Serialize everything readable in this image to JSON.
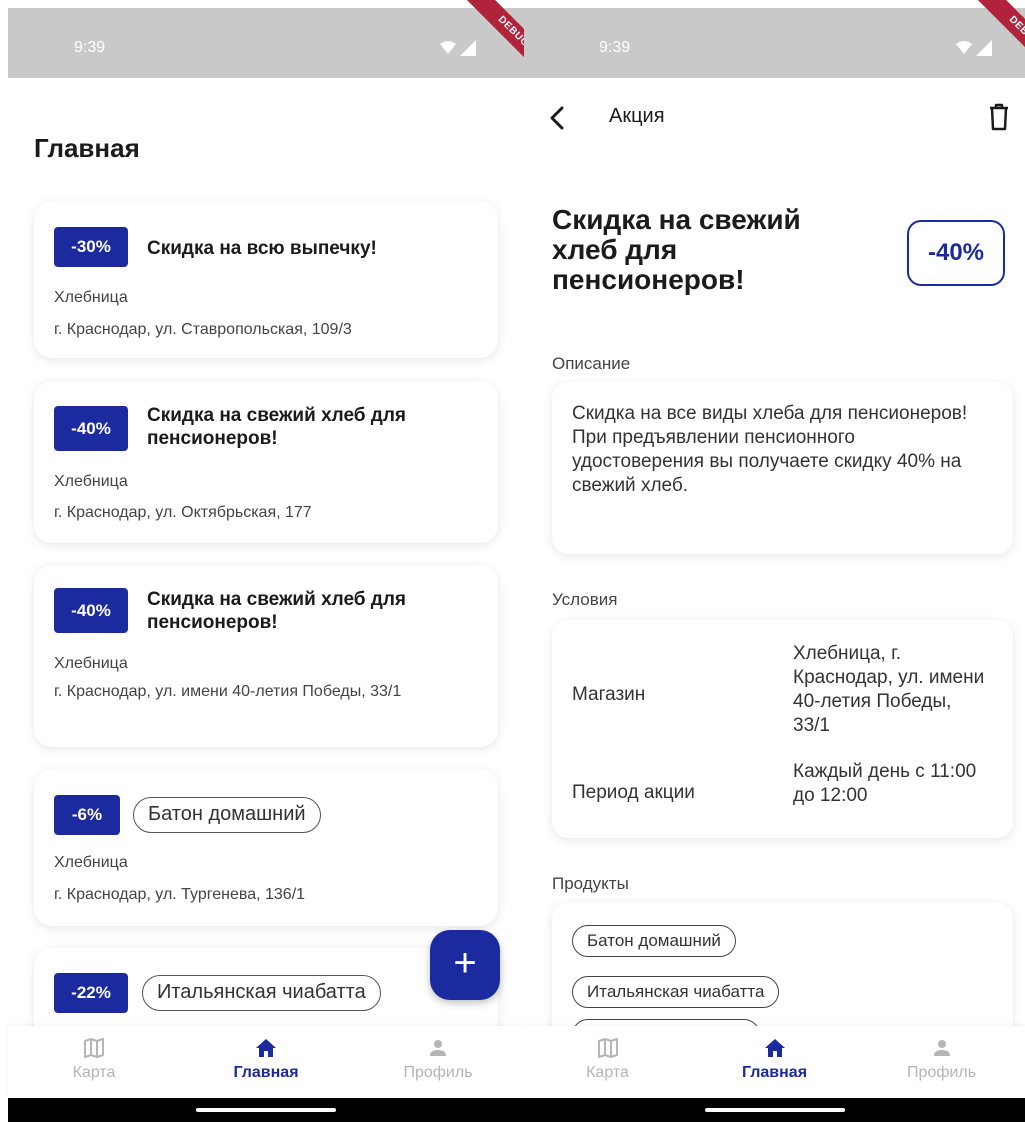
{
  "status_bar": {
    "time": "9:39",
    "debug_label": "DEBUG"
  },
  "home": {
    "title": "Главная",
    "promos": [
      {
        "discount": "-30%",
        "title": "Скидка на всю выпечку!",
        "shop": "Хлебница",
        "address": "г. Краснодар, ул. Ставропольская, 109/3"
      },
      {
        "discount": "-40%",
        "title": "Скидка на свежий хлеб для пенсионеров!",
        "shop": "Хлебница",
        "address": "г. Краснодар, ул. Октябрьская, 177"
      },
      {
        "discount": "-40%",
        "title": "Скидка на свежий хлеб для пенсионеров!",
        "shop": "Хлебница",
        "address": "г. Краснодар, ул. имени 40-летия Победы, 33/1"
      },
      {
        "discount": "-6%",
        "title": "Батон домашний",
        "shop": "Хлебница",
        "address": "г. Краснодар, ул. Тургенева, 136/1"
      },
      {
        "discount": "-22%",
        "title": "Итальянская чиабатта"
      }
    ],
    "fab_label": "+"
  },
  "detail": {
    "bar_title": "Акция",
    "title": "Скидка на свежий хлеб для пенсионеров!",
    "discount": "-40%",
    "description_label": "Описание",
    "description": "Скидка на все виды хлеба для пенсионеров! При предъявлении пенсионного удостоверения вы получаете скидку 40% на свежий хлеб.",
    "conditions_label": "Условия",
    "shop_label": "Магазин",
    "shop_value": "Хлебница, г. Краснодар, ул. имени 40-летия Победы, 33/1",
    "period_label": "Период акции",
    "period_value": "Каждый день с 11:00 до 12:00",
    "products_label": "Продукты",
    "products": [
      "Батон домашний",
      "Итальянская чиабатта"
    ]
  },
  "bottom_nav": {
    "items": [
      {
        "label": "Карта",
        "icon": "map-icon"
      },
      {
        "label": "Главная",
        "icon": "home-icon"
      },
      {
        "label": "Профиль",
        "icon": "person-icon"
      }
    ],
    "active_index": 1
  },
  "colors": {
    "primary": "#1c2aa0",
    "status_bar": "#c9c9c9",
    "debug_banner": "#b0233a"
  }
}
